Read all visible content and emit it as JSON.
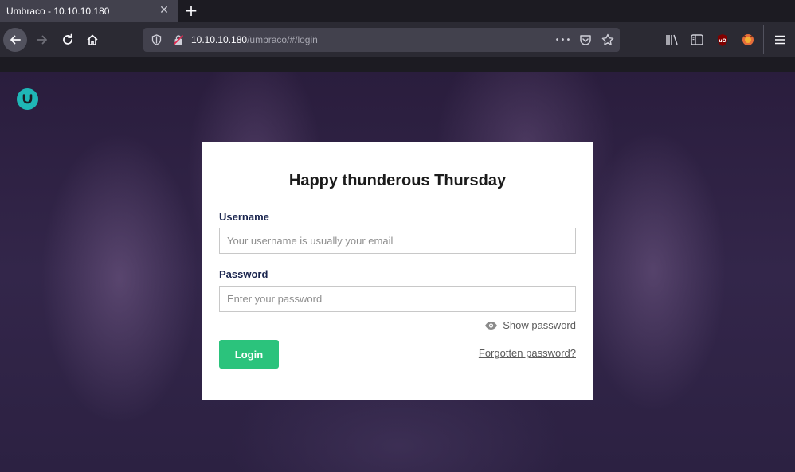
{
  "browser": {
    "tab_title": "Umbraco - 10.10.10.180",
    "tab_close": "✕",
    "new_tab": "+",
    "url_host": "10.10.10.180",
    "url_path": "/umbraco/#/login",
    "url_more": "•••"
  },
  "login": {
    "greeting": "Happy thunderous Thursday",
    "username_label": "Username",
    "username_placeholder": "Your username is usually your email",
    "password_label": "Password",
    "password_placeholder": "Enter your password",
    "show_password": "Show password",
    "login_button": "Login",
    "forgot_link": "Forgotten password?"
  },
  "colors": {
    "accent": "#2bc37c",
    "logo": "#1fb6b6",
    "background": "#2a1d3d"
  }
}
